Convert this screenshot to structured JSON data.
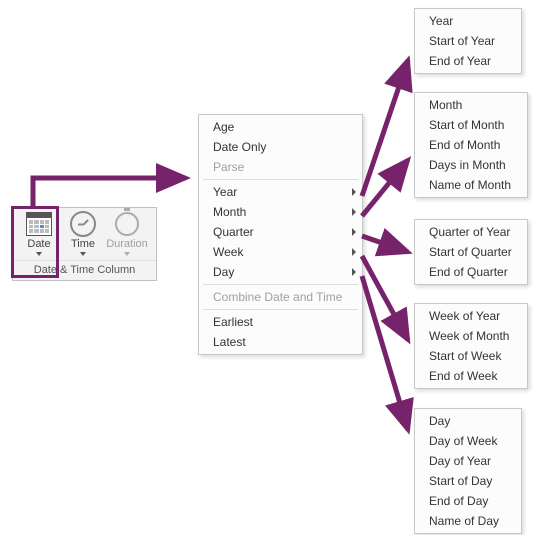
{
  "ribbon": {
    "group_label": "Date & Time Column",
    "buttons": {
      "date": "Date",
      "time": "Time",
      "duration": "Duration"
    }
  },
  "main_menu": {
    "age": "Age",
    "date_only": "Date Only",
    "parse": "Parse",
    "year": "Year",
    "month": "Month",
    "quarter": "Quarter",
    "week": "Week",
    "day": "Day",
    "combine": "Combine Date and Time",
    "earliest": "Earliest",
    "latest": "Latest"
  },
  "sub_year": {
    "year": "Year",
    "start": "Start of Year",
    "end": "End of Year"
  },
  "sub_month": {
    "month": "Month",
    "start": "Start of Month",
    "end": "End of Month",
    "days": "Days in Month",
    "name": "Name of Month"
  },
  "sub_quarter": {
    "quarter": "Quarter of Year",
    "start": "Start of Quarter",
    "end": "End of Quarter"
  },
  "sub_week": {
    "week_year": "Week of Year",
    "week_month": "Week of Month",
    "start": "Start of Week",
    "end": "End of Week"
  },
  "sub_day": {
    "day": "Day",
    "dow": "Day of Week",
    "doy": "Day of Year",
    "start": "Start of Day",
    "end": "End of Day",
    "name": "Name of Day"
  }
}
